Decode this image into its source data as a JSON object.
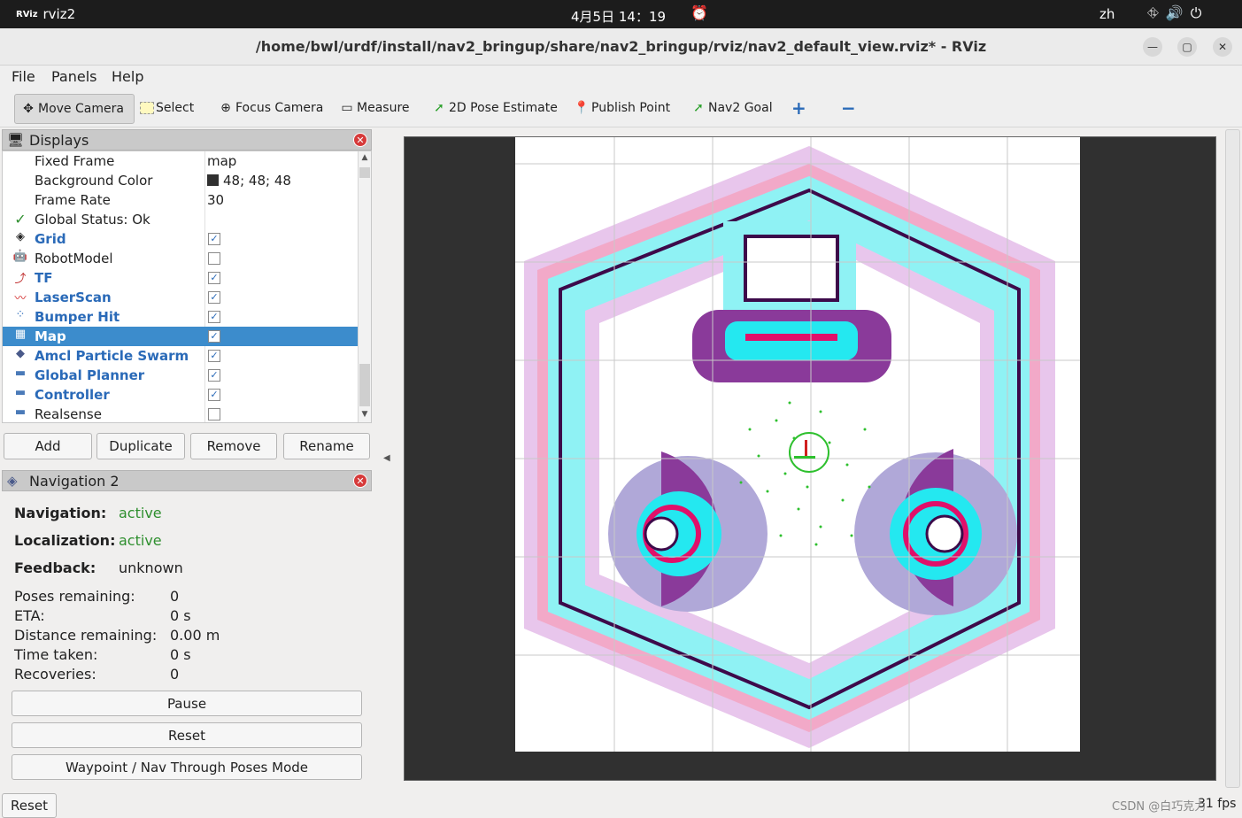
{
  "topbar": {
    "app_icon": "rviz-icon",
    "app_name": "rviz2",
    "clock": "4月5日 14：19",
    "lang": "zh"
  },
  "window": {
    "title": "/home/bwl/urdf/install/nav2_bringup/share/nav2_bringup/rviz/nav2_default_view.rviz* - RViz"
  },
  "menu": {
    "file": "File",
    "panels": "Panels",
    "help": "Help"
  },
  "toolbar": {
    "move_camera": "Move Camera",
    "select": "Select",
    "focus_camera": "Focus Camera",
    "measure": "Measure",
    "pose_estimate": "2D Pose Estimate",
    "publish_point": "Publish Point",
    "nav2_goal": "Nav2 Goal",
    "add": "+",
    "remove": "−"
  },
  "displays": {
    "title": "Displays",
    "props": [
      {
        "name": "Fixed Frame",
        "value": "map"
      },
      {
        "name": "Background Color",
        "value": "48; 48; 48",
        "swatch": "#303030"
      },
      {
        "name": "Frame Rate",
        "value": "30"
      },
      {
        "name": "Global Status: Ok",
        "value": ""
      }
    ],
    "items": [
      {
        "name": "Grid",
        "checked": true,
        "icon": "grid-icon"
      },
      {
        "name": "RobotModel",
        "checked": false,
        "icon": "robot-icon"
      },
      {
        "name": "TF",
        "checked": true,
        "icon": "tf-icon"
      },
      {
        "name": "LaserScan",
        "checked": true,
        "icon": "laser-icon"
      },
      {
        "name": "Bumper Hit",
        "checked": true,
        "icon": "points-icon"
      },
      {
        "name": "Map",
        "checked": true,
        "icon": "map-icon",
        "selected": true
      },
      {
        "name": "Amcl Particle Swarm",
        "checked": true,
        "icon": "particle-icon"
      },
      {
        "name": "Global Planner",
        "checked": true,
        "icon": "folder-icon"
      },
      {
        "name": "Controller",
        "checked": true,
        "icon": "folder-icon"
      },
      {
        "name": "Realsense",
        "checked": false,
        "icon": "folder-icon"
      }
    ],
    "buttons": {
      "add": "Add",
      "duplicate": "Duplicate",
      "remove": "Remove",
      "rename": "Rename"
    }
  },
  "navigation": {
    "title": "Navigation 2",
    "navigation_label": "Navigation:",
    "navigation_value": "active",
    "localization_label": "Localization:",
    "localization_value": "active",
    "feedback_label": "Feedback:",
    "feedback_value": "unknown",
    "poses_label": "Poses remaining:",
    "poses_value": "0",
    "eta_label": "ETA:",
    "eta_value": "0 s",
    "distance_label": "Distance remaining:",
    "distance_value": "0.00 m",
    "time_label": "Time taken:",
    "time_value": "0 s",
    "recoveries_label": "Recoveries:",
    "recoveries_value": "0",
    "pause": "Pause",
    "reset": "Reset",
    "waypoint": "Waypoint / Nav Through Poses Mode"
  },
  "status": {
    "reset": "Reset",
    "fps": "31 fps",
    "watermark": "CSDN @白巧克力"
  }
}
